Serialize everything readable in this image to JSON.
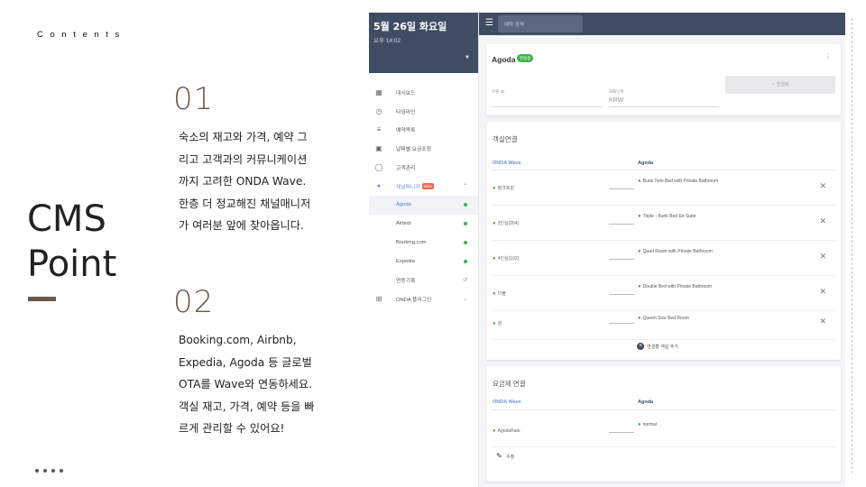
{
  "slide": {
    "contents_label": "Contents",
    "title_line1": "CMS",
    "title_line2": "Point",
    "sections": [
      {
        "number": "01",
        "lines": [
          "숙소의 재고와 가격, 예약 그",
          "리고 고객과의 커뮤니케이션",
          "까지 고려한 ONDA Wave.",
          "한층 더 정교해진 채널매니저",
          "가 여러분 앞에 찾아옵니다."
        ]
      },
      {
        "number": "02",
        "lines": [
          "Booking.com, Airbnb,",
          "Expedia, Agoda 등 글로벌",
          "OTA를 Wave와 연동하세요.",
          "객실 재고, 가격, 예약 등을 빠",
          "르게 관리할 수 있어요!"
        ]
      }
    ]
  },
  "app": {
    "header": {
      "date": "5월 26일 화요일",
      "time": "오후 14:02"
    },
    "search_placeholder": "예약 검색",
    "nav": [
      {
        "label": "대시보드",
        "icon": "dashboard-icon"
      },
      {
        "label": "타임라인",
        "icon": "clock-icon"
      },
      {
        "label": "예약목록",
        "icon": "list-check-icon"
      },
      {
        "label": "날짜별 요금조정",
        "icon": "calendar-edit-icon"
      },
      {
        "label": "고객관리",
        "icon": "user-circle-icon"
      },
      {
        "label": "채널매니저",
        "icon": "share-icon",
        "badge": "NEW"
      },
      {
        "label": "Agoda"
      },
      {
        "label": "Airbnb"
      },
      {
        "label": "Booking.com"
      },
      {
        "label": "Expedia"
      },
      {
        "label": "연동기록",
        "icon": "history-icon"
      },
      {
        "label": "ONDA 플러그인",
        "icon": "plugin-icon"
      }
    ],
    "channel_card": {
      "title": "Agoda",
      "status_badge": "연동중",
      "hotel_id_label": "호텔 ID",
      "currency_label": "화폐단위",
      "currency_value": "KRW",
      "connect_button": "연결됨"
    },
    "room_mapping": {
      "title": "객실연결",
      "col_left": "ONDA Wave",
      "col_right": "Agoda",
      "rows": [
        {
          "left": "벙크트윈",
          "right": "Bunk Twin Bed with Private Bathroom"
        },
        {
          "left": "3인실(204)",
          "right": "Triple - Bunk Bed En Suite"
        },
        {
          "left": "4인실(102)",
          "right": "Quad Room with Private Bathroom"
        },
        {
          "left": "더블",
          "right": "Double Bed with Private Bathroom"
        },
        {
          "left": "퀸",
          "right": "Queen Size Bed Room"
        }
      ],
      "add_label": "연결할 객실 추가"
    },
    "rate_mapping": {
      "title": "요금제 연결",
      "col_left": "ONDA Wave",
      "col_right": "Agoda",
      "row_left": "AgodaRate",
      "row_right": "normal",
      "edit_label": "수정"
    }
  }
}
